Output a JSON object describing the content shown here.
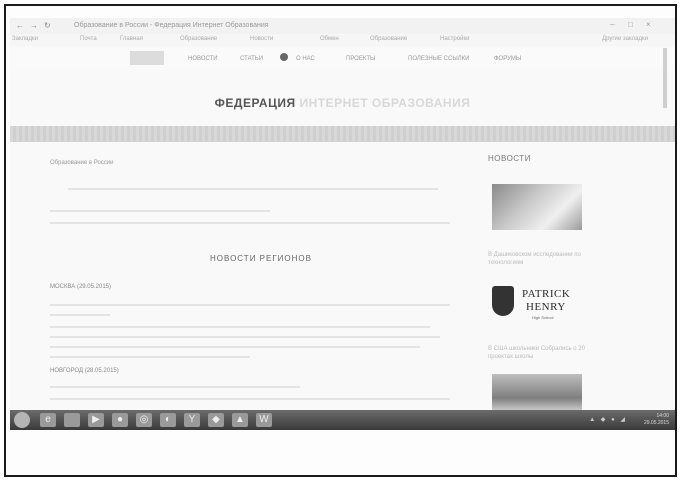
{
  "browser": {
    "tab_title": "Образование в России - Федерация Интернет Образования",
    "back": "←",
    "forward": "→",
    "reload": "↻",
    "bookmarks": [
      "Закладки",
      "Почта",
      "Главная",
      "Образование",
      "Новости",
      "Обмен",
      "Образование",
      "Настройки",
      "Другие закладки"
    ],
    "window_controls": [
      "–",
      "□",
      "×"
    ]
  },
  "site_nav": {
    "items": [
      "Новости",
      "Статьи",
      "О нас",
      "Проекты",
      "Полезные ссылки",
      "Форумы"
    ]
  },
  "header": {
    "dark": "ФЕДЕРАЦИЯ",
    "light": "ИНТЕРНЕТ ОБРАЗОВАНИЯ"
  },
  "content": {
    "crumb": "Образование в России",
    "heading": "НОВОСТИ РЕГИОНОВ",
    "section1": "МОСКВА (29.05.2015)",
    "section2": "НОВГОРОД (28.05.2015)"
  },
  "sidebar": {
    "title": "НОВОСТИ",
    "caption1": "В Дашиковском исследовании по технологиям",
    "caption2": "В США школьники Собрались о 20 проектах школы",
    "logo_line1": "PATRICK",
    "logo_line2": "HENRY",
    "logo_line3": "High School"
  },
  "taskbar": {
    "icons": [
      "ie-icon",
      "folder-icon",
      "media-icon",
      "chrome-icon",
      "yandex-icon",
      "word-icon"
    ],
    "time": "14:00",
    "date": "29.05.2015"
  }
}
